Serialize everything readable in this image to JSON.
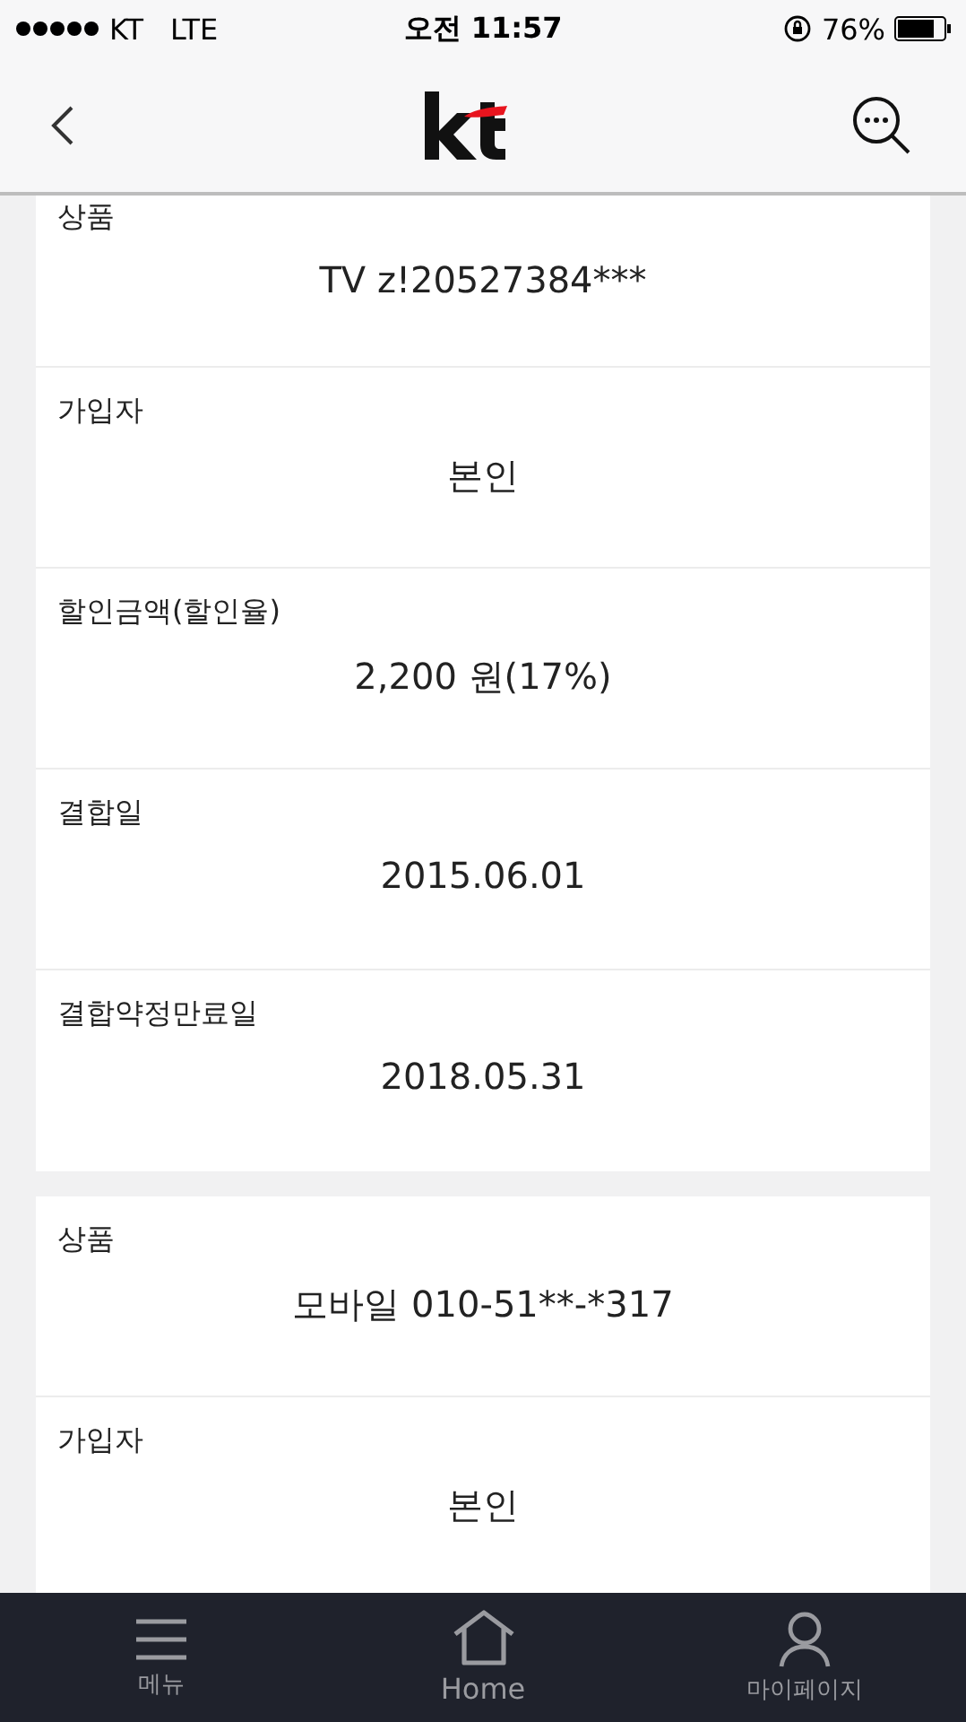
{
  "status_bar": {
    "carrier": "KT",
    "network": "LTE",
    "time": "오전 11:57",
    "battery": "76%"
  },
  "cards": [
    {
      "rows": [
        {
          "label": "상품",
          "value": "TV z!20527384***"
        },
        {
          "label": "가입자",
          "value": "본인"
        },
        {
          "label": "할인금액(할인율)",
          "value": "2,200 원(17%)"
        },
        {
          "label": "결합일",
          "value": "2015.06.01"
        },
        {
          "label": "결합약정만료일",
          "value": "2018.05.31"
        }
      ]
    },
    {
      "rows": [
        {
          "label": "상품",
          "value": "모바일 010-51**-*317"
        },
        {
          "label": "가입자",
          "value": "본인"
        }
      ]
    }
  ],
  "bottom_nav": [
    {
      "kind": "menu",
      "label": "메뉴"
    },
    {
      "kind": "home",
      "label": "Home"
    },
    {
      "kind": "profile",
      "label": "마이페이지"
    }
  ]
}
